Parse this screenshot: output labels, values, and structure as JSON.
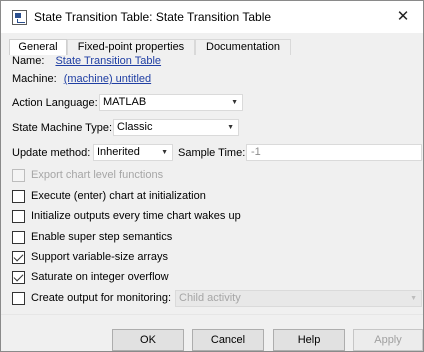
{
  "window": {
    "title": "State Transition Table: State Transition Table",
    "close_glyph": "✕"
  },
  "tabs": [
    {
      "label": "General",
      "active": true
    },
    {
      "label": "Fixed-point properties",
      "active": false
    },
    {
      "label": "Documentation",
      "active": false
    }
  ],
  "general": {
    "name_label": "Name:",
    "name_value": "State Transition Table",
    "machine_label": "Machine:",
    "machine_value": "(machine) untitled",
    "action_language_label": "Action Language:",
    "action_language_value": "MATLAB",
    "state_machine_type_label": "State Machine Type:",
    "state_machine_type_value": "Classic",
    "update_method_label": "Update method:",
    "update_method_value": "Inherited",
    "sample_time_label": "Sample Time:",
    "sample_time_value": "-1",
    "monitoring_value": "Child activity"
  },
  "checkboxes": [
    {
      "label": "Export chart level functions",
      "checked": false,
      "disabled": true
    },
    {
      "label": "Execute (enter) chart at initialization",
      "checked": false,
      "disabled": false
    },
    {
      "label": "Initialize outputs every time chart wakes up",
      "checked": false,
      "disabled": false
    },
    {
      "label": "Enable super step semantics",
      "checked": false,
      "disabled": false
    },
    {
      "label": "Support variable-size arrays",
      "checked": true,
      "disabled": false
    },
    {
      "label": "Saturate on integer overflow",
      "checked": true,
      "disabled": false
    },
    {
      "label": "Create output for monitoring:",
      "checked": false,
      "disabled": false
    }
  ],
  "buttons": {
    "ok": "OK",
    "cancel": "Cancel",
    "help": "Help",
    "apply": "Apply"
  },
  "icons": {
    "app": "stateflow-chart-icon",
    "dropdown": "chevron-down-icon"
  }
}
